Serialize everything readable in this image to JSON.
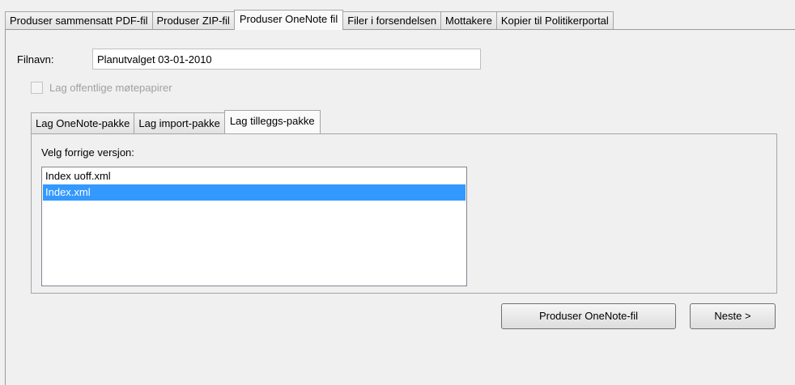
{
  "top_tabs": [
    {
      "label": "Produser sammensatt PDF-fil",
      "active": false
    },
    {
      "label": "Produser ZIP-fil",
      "active": false
    },
    {
      "label": "Produser OneNote fil",
      "active": true
    },
    {
      "label": "Filer i forsendelsen",
      "active": false
    },
    {
      "label": "Mottakere",
      "active": false
    },
    {
      "label": "Kopier til Politikerportal",
      "active": false
    }
  ],
  "filename": {
    "label": "Filnavn:",
    "value": "Planutvalget 03-01-2010"
  },
  "checkbox": {
    "label": "Lag offentlige møtepapirer",
    "checked": false,
    "disabled": true
  },
  "sub_tabs": [
    {
      "label": "Lag OneNote-pakke",
      "active": false
    },
    {
      "label": "Lag import-pakke",
      "active": false
    },
    {
      "label": "Lag tilleggs-pakke",
      "active": true
    }
  ],
  "previous_version": {
    "label": "Velg forrige versjon:",
    "items": [
      {
        "label": "Index uoff.xml",
        "selected": false
      },
      {
        "label": "Index.xml",
        "selected": true
      }
    ]
  },
  "buttons": {
    "produce": "Produser OneNote-fil",
    "next": "Neste >"
  },
  "colors": {
    "selection": "#3399ff",
    "background": "#f0f0f0"
  }
}
